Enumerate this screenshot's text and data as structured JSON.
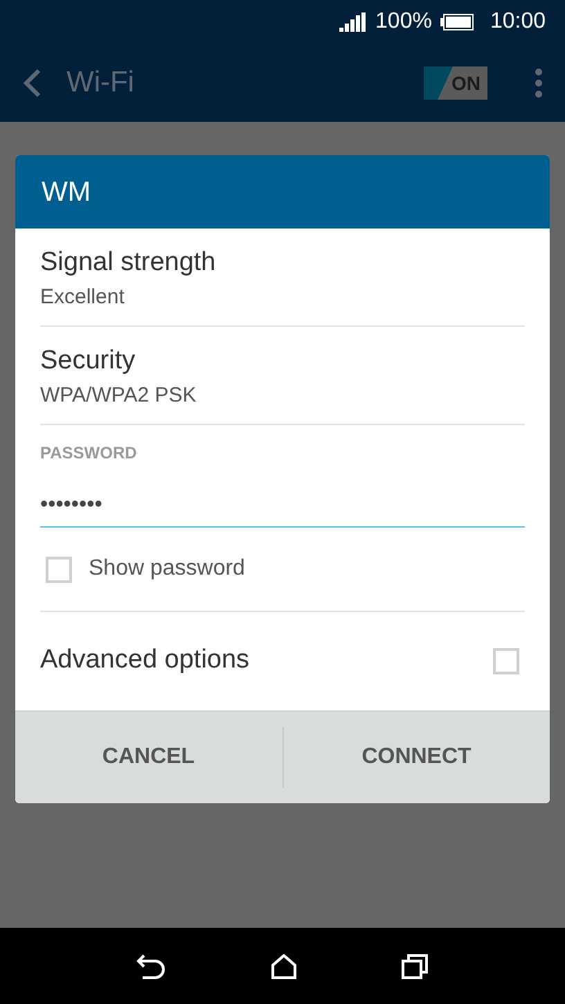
{
  "status_bar": {
    "battery": "100%",
    "time": "10:00"
  },
  "app_bar": {
    "title": "Wi-Fi",
    "toggle": {
      "label": "ON",
      "on": true
    }
  },
  "dialog": {
    "title": "WM",
    "info": [
      {
        "label": "Signal strength",
        "value": "Excellent"
      },
      {
        "label": "Security",
        "value": "WPA/WPA2 PSK"
      }
    ],
    "password": {
      "label": "PASSWORD",
      "value": "••••••••"
    },
    "show_password": {
      "label": "Show password",
      "checked": false
    },
    "advanced_options": {
      "label": "Advanced options",
      "checked": false
    },
    "buttons": [
      "CANCEL",
      "CONNECT"
    ]
  }
}
